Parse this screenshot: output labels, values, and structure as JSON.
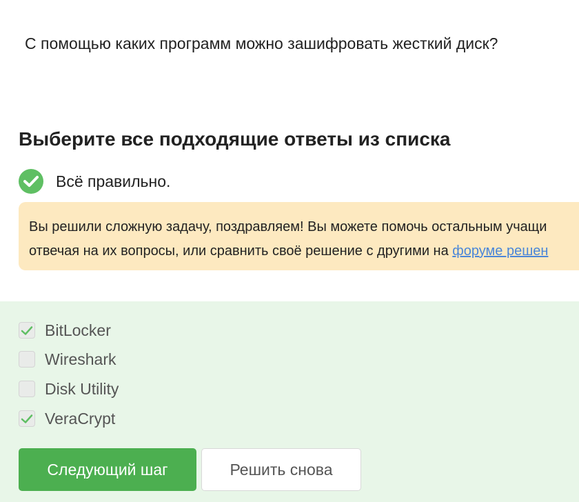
{
  "question": "С помощью каких программ можно зашифровать жесткий диск?",
  "instruction": "Выберите все подходящие ответы из списка",
  "result": {
    "icon": "checkmark-circle-icon",
    "text": "Всё правильно.",
    "color": "#5fbf63"
  },
  "hint": {
    "line1": "Вы решили сложную задачу, поздравляем! Вы можете помочь остальным учащи",
    "line2_prefix": "отвечая на их вопросы, или сравнить своё решение с другими на ",
    "link_text": "форуме решен",
    "background": "#fde9c0"
  },
  "options": [
    {
      "label": "BitLocker",
      "checked": true
    },
    {
      "label": "Wireshark",
      "checked": false
    },
    {
      "label": "Disk Utility",
      "checked": false
    },
    {
      "label": "VeraCrypt",
      "checked": true
    }
  ],
  "buttons": {
    "next": "Следующий шаг",
    "retry": "Решить снова"
  },
  "colors": {
    "accent": "#4caf50",
    "panel": "#e8f6e8",
    "link": "#4a86d8"
  }
}
